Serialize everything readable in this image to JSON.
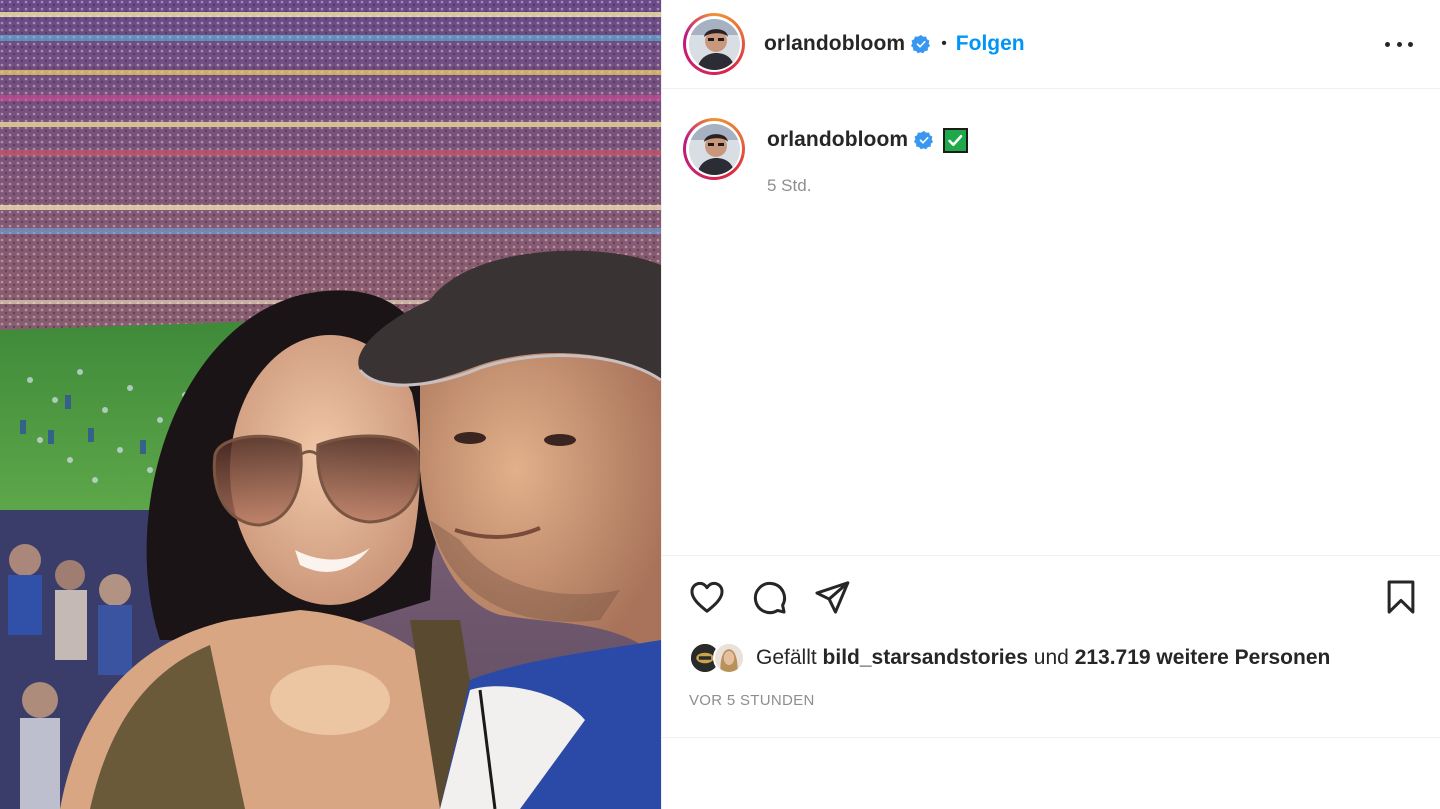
{
  "header": {
    "username": "orlandobloom",
    "separator": "•",
    "follow_label": "Folgen"
  },
  "caption": {
    "username": "orlandobloom",
    "emoji": "✅",
    "time": "5 Std."
  },
  "likes": {
    "prefix": "Gefällt",
    "liker": "bild_starsandstories",
    "middle": "und",
    "count_text": "213.719 weitere Personen"
  },
  "posted_ago": "VOR 5 STUNDEN",
  "icons": {
    "verified": "verified-badge-icon",
    "more": "more-options-icon",
    "like": "heart-icon",
    "comment": "comment-icon",
    "share": "paper-plane-icon",
    "save": "bookmark-icon"
  },
  "colors": {
    "accent": "#0095f6",
    "text": "#262626",
    "muted": "#8e8e8e",
    "verified": "#3897f0"
  }
}
